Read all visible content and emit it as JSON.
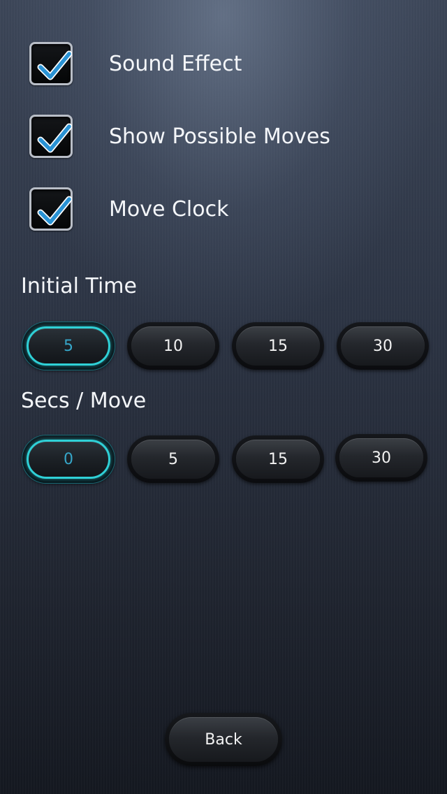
{
  "options": {
    "sound_effect": {
      "label": "Sound Effect",
      "checked": true
    },
    "show_possible_moves": {
      "label": "Show Possible Moves",
      "checked": true
    },
    "move_clock": {
      "label": "Move Clock",
      "checked": true
    }
  },
  "initial_time": {
    "title": "Initial Time",
    "options": [
      "5",
      "10",
      "15",
      "30"
    ],
    "selected": "5"
  },
  "secs_per_move": {
    "title": "Secs / Move",
    "options": [
      "0",
      "5",
      "15",
      "30"
    ],
    "selected": "0"
  },
  "back_label": "Back",
  "icons": {
    "checkmark": "checkmark-icon"
  },
  "colors": {
    "accent": "#2fd0d6",
    "selected_text": "#36a6c9",
    "checkmark": "#2a93d5"
  }
}
